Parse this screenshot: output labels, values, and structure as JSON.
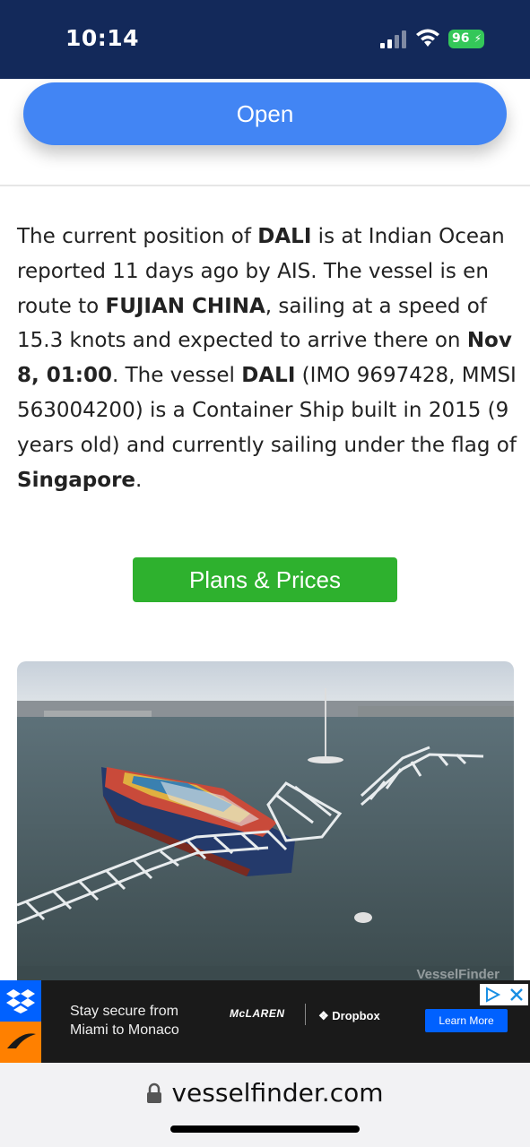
{
  "status_bar": {
    "time": "10:14",
    "battery": "96"
  },
  "open_button": {
    "label": "Open"
  },
  "description": {
    "p1": "The current position of ",
    "vessel": "DALI",
    "p2": " is at Indian Ocean reported 11 days ago by AIS. The vessel is en route to ",
    "destination": "FUJIAN CHINA",
    "p3": ", sailing at a speed of 15.3 knots and expected to arrive there on ",
    "eta": "Nov 8, 01:00",
    "p4": ". The vessel ",
    "p5": " (IMO 9697428, MMSI 563004200) is a Container Ship built in 2015 (9 years old) and currently sailing under the flag of ",
    "flag": "Singapore",
    "p6": "."
  },
  "plans_button": {
    "label": "Plans & Prices"
  },
  "photo": {
    "watermark": "VesselFinder"
  },
  "ad": {
    "line1": "Stay secure from",
    "line2": "Miami to Monaco",
    "brand1": "McLAREN",
    "brand2": "Dropbox",
    "cta": "Learn More"
  },
  "browser": {
    "domain": "vesselfinder.com"
  },
  "colors": {
    "status_bar": "#13295a",
    "open_button": "#4285f4",
    "plans_button": "#2eb12e",
    "battery": "#34c759"
  }
}
